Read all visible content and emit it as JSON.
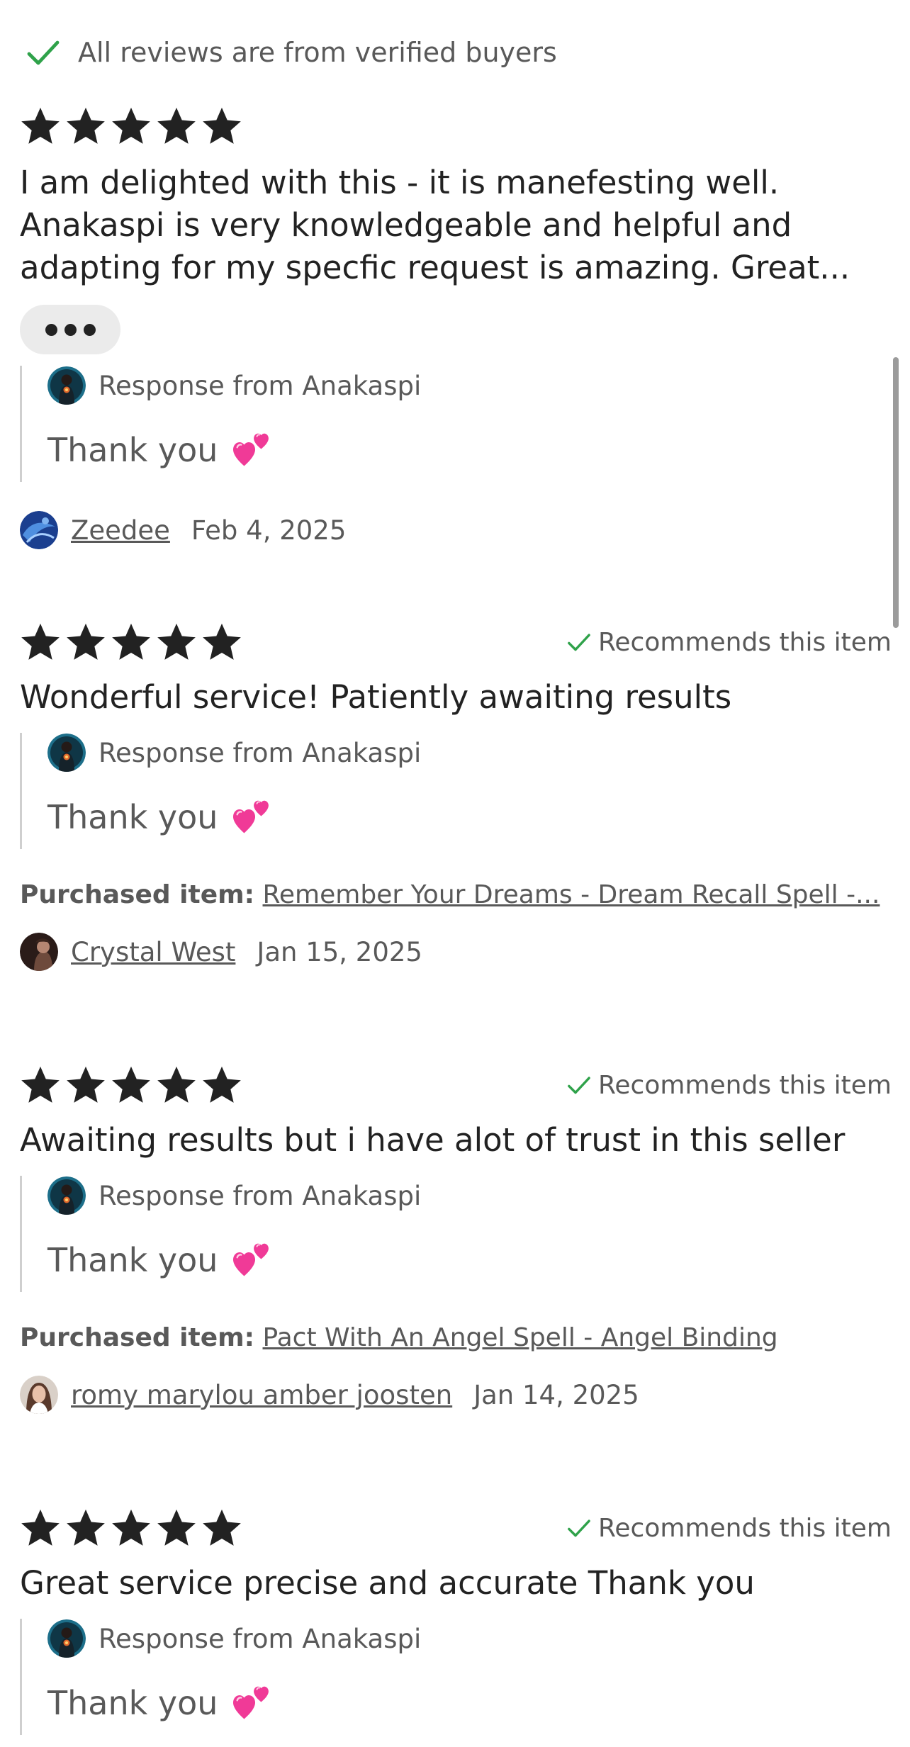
{
  "verified_banner": {
    "text": "All reviews are from verified buyers",
    "icon": "check-icon",
    "icon_color": "#2fa24a"
  },
  "colors": {
    "star": "#222222",
    "check": "#2fa24a",
    "muted_text": "#595959",
    "heart": "#f03a97"
  },
  "reviews": [
    {
      "rating": 5,
      "recommends": "",
      "text": "I am delighted with this - it is manefesting well. Anakaspi is very knowledgeable and helpful and adapting for my specfic request is amazing. Great...",
      "response": {
        "title": "Response from Anakaspi",
        "text": "Thank you",
        "emoji_icon": "two-hearts-icon"
      },
      "purchased_label": "",
      "purchased_item": "",
      "reviewer": "Zeedee",
      "date": "Feb 4, 2025"
    },
    {
      "rating": 5,
      "recommends": "Recommends this item",
      "text": "Wonderful service! Patiently awaiting results",
      "response": {
        "title": "Response from Anakaspi",
        "text": "Thank you",
        "emoji_icon": "two-hearts-icon"
      },
      "purchased_label": "Purchased item:",
      "purchased_item": "Remember Your Dreams - Dream Recall Spell -...",
      "reviewer": "Crystal West",
      "date": "Jan 15, 2025"
    },
    {
      "rating": 5,
      "recommends": "Recommends this item",
      "text": "Awaiting results but i have alot of trust in this seller",
      "response": {
        "title": "Response from Anakaspi",
        "text": "Thank you",
        "emoji_icon": "two-hearts-icon"
      },
      "purchased_label": "Purchased item:",
      "purchased_item": "Pact With An Angel Spell - Angel Binding",
      "reviewer": "romy marylou amber joosten",
      "date": "Jan 14, 2025"
    },
    {
      "rating": 5,
      "recommends": "Recommends this item",
      "text": "Great service precise and accurate Thank you",
      "response": {
        "title": "Response from Anakaspi",
        "text": "Thank you",
        "emoji_icon": "two-hearts-icon"
      }
    }
  ]
}
